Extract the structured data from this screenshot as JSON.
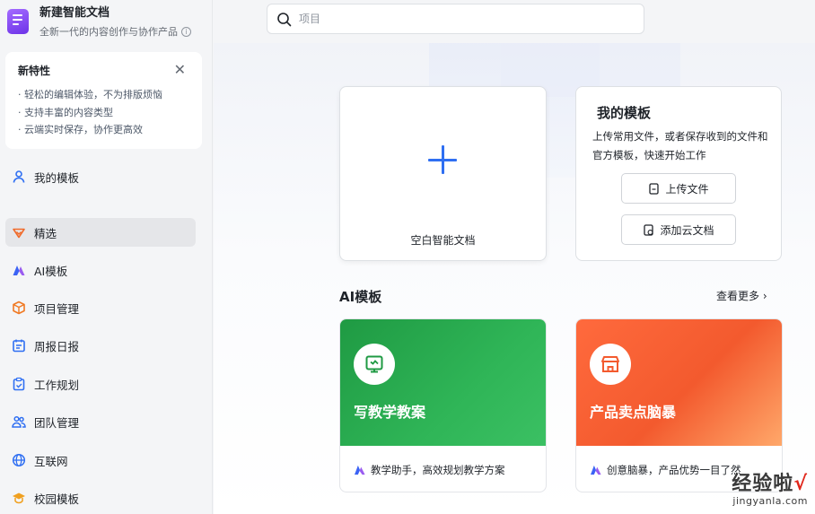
{
  "brand": {
    "title": "新建智能文档",
    "subtitle": "全新一代的内容创作与协作产品",
    "info_icon": "ⓘ"
  },
  "feature_card": {
    "title": "新特性",
    "close": "✕",
    "items": [
      "· 轻松的编辑体验，不为排版烦恼",
      "· 支持丰富的内容类型",
      "· 云端实时保存，协作更高效"
    ]
  },
  "sidebar": {
    "items": [
      {
        "label": "我的模板",
        "icon": "user-icon",
        "color": "#2f6ff2"
      },
      {
        "label": "精选",
        "icon": "selected-icon",
        "color": "#f06a2a"
      },
      {
        "label": "AI模板",
        "icon": "ai-logo-icon",
        "color": "#3b63f5"
      },
      {
        "label": "项目管理",
        "icon": "box-icon",
        "color": "#f07a24"
      },
      {
        "label": "周报日报",
        "icon": "calendar-icon",
        "color": "#2f6ff2"
      },
      {
        "label": "工作规划",
        "icon": "clipboard-icon",
        "color": "#2f6ff2"
      },
      {
        "label": "团队管理",
        "icon": "team-icon",
        "color": "#2f6ff2"
      },
      {
        "label": "互联网",
        "icon": "globe-icon",
        "color": "#2f6ff2"
      },
      {
        "label": "校园模板",
        "icon": "graduation-icon",
        "color": "#f0a020"
      }
    ],
    "active_index": 1
  },
  "search": {
    "placeholder": "项目"
  },
  "blank_doc": {
    "label": "空白智能文档"
  },
  "my_templates": {
    "title": "我的模板",
    "description": "上传常用文件，或者保存收到的文件和官方模板，快速开始工作",
    "upload_label": "上传文件",
    "cloud_label": "添加云文档"
  },
  "ai_section": {
    "title": "AI模板",
    "more_label": "查看更多 ›",
    "cards": [
      {
        "title": "写教学教案",
        "desc": "教学助手，高效规划教学方案",
        "color": "#2aaa4f"
      },
      {
        "title": "产品卖点脑暴",
        "desc": "创意脑暴，产品优势一目了然",
        "color": "#f35a2e"
      }
    ]
  },
  "watermark": {
    "main": "经验啦",
    "check": "√",
    "sub": "jingyanla.com"
  }
}
